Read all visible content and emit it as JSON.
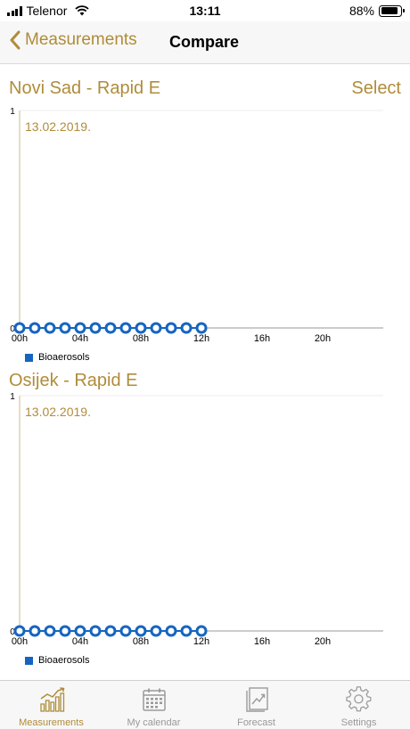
{
  "status_bar": {
    "carrier": "Telenor",
    "time": "13:11",
    "battery_text": "88%",
    "battery_level": 0.88
  },
  "nav": {
    "back_label": "Measurements",
    "title": "Compare"
  },
  "select_label": "Select",
  "colors": {
    "accent": "#b08c3a",
    "series": "#1565c0"
  },
  "chart_data": [
    {
      "type": "line",
      "title": "Novi Sad - Rapid E",
      "annotation": "13.02.2019.",
      "x_ticks": [
        "00h",
        "04h",
        "08h",
        "12h",
        "16h",
        "20h"
      ],
      "x_tick_hours": [
        0,
        4,
        8,
        12,
        16,
        20
      ],
      "xlim": [
        0,
        24
      ],
      "y_ticks": [
        "1",
        "0"
      ],
      "ylim": [
        0,
        1
      ],
      "grid": false,
      "legend": "bottom-left",
      "series": [
        {
          "name": "Bioaerosols",
          "x": [
            0,
            1,
            2,
            3,
            4,
            5,
            6,
            7,
            8,
            9,
            10,
            11,
            12
          ],
          "values": [
            0,
            0,
            0,
            0,
            0,
            0,
            0,
            0,
            0,
            0,
            0,
            0,
            0
          ]
        }
      ]
    },
    {
      "type": "line",
      "title": "Osijek - Rapid E",
      "annotation": "13.02.2019.",
      "x_ticks": [
        "00h",
        "04h",
        "08h",
        "12h",
        "16h",
        "20h"
      ],
      "x_tick_hours": [
        0,
        4,
        8,
        12,
        16,
        20
      ],
      "xlim": [
        0,
        24
      ],
      "y_ticks": [
        "1",
        "0"
      ],
      "ylim": [
        0,
        1
      ],
      "grid": false,
      "legend": "bottom-left",
      "series": [
        {
          "name": "Bioaerosols",
          "x": [
            0,
            1,
            2,
            3,
            4,
            5,
            6,
            7,
            8,
            9,
            10,
            11,
            12
          ],
          "values": [
            0,
            0,
            0,
            0,
            0,
            0,
            0,
            0,
            0,
            0,
            0,
            0,
            0
          ]
        }
      ]
    }
  ],
  "tabs": [
    {
      "label": "Measurements",
      "icon": "bar-chart-icon",
      "active": true
    },
    {
      "label": "My calendar",
      "icon": "calendar-icon",
      "active": false
    },
    {
      "label": "Forecast",
      "icon": "forecast-icon",
      "active": false
    },
    {
      "label": "Settings",
      "icon": "gear-icon",
      "active": false
    }
  ]
}
